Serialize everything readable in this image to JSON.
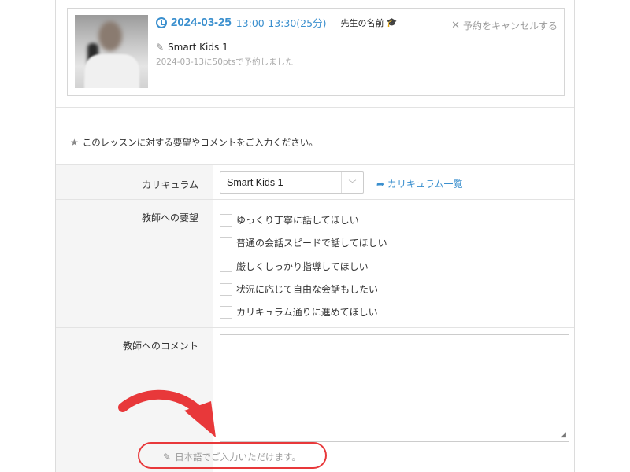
{
  "reservation": {
    "date": "2024-03-25",
    "time": "13:00-13:30(25分)",
    "teacher": "先生の名前",
    "course": "Smart Kids 1",
    "booked_note": "2024-03-13に50ptsで予約しました",
    "cancel_label": "予約をキャンセルする"
  },
  "form": {
    "note": "このレッスンに対する要望やコメントをご入力ください。",
    "curriculum": {
      "label": "カリキュラム",
      "selected": "Smart Kids 1",
      "link": "カリキュラム一覧"
    },
    "requests": {
      "label": "教師への要望",
      "options": [
        "ゆっくり丁寧に話してほしい",
        "普通の会話スピードで話してほしい",
        "厳しくしっかり指導してほしい",
        "状況に応じて自由な会話もしたい",
        "カリキュラム通りに進めてほしい"
      ]
    },
    "comment": {
      "label": "教師へのコメント",
      "value": "",
      "hint": "日本語でご入力いただけます。"
    }
  },
  "colors": {
    "accent": "#3a8fce",
    "annotation": "#e8383a"
  }
}
